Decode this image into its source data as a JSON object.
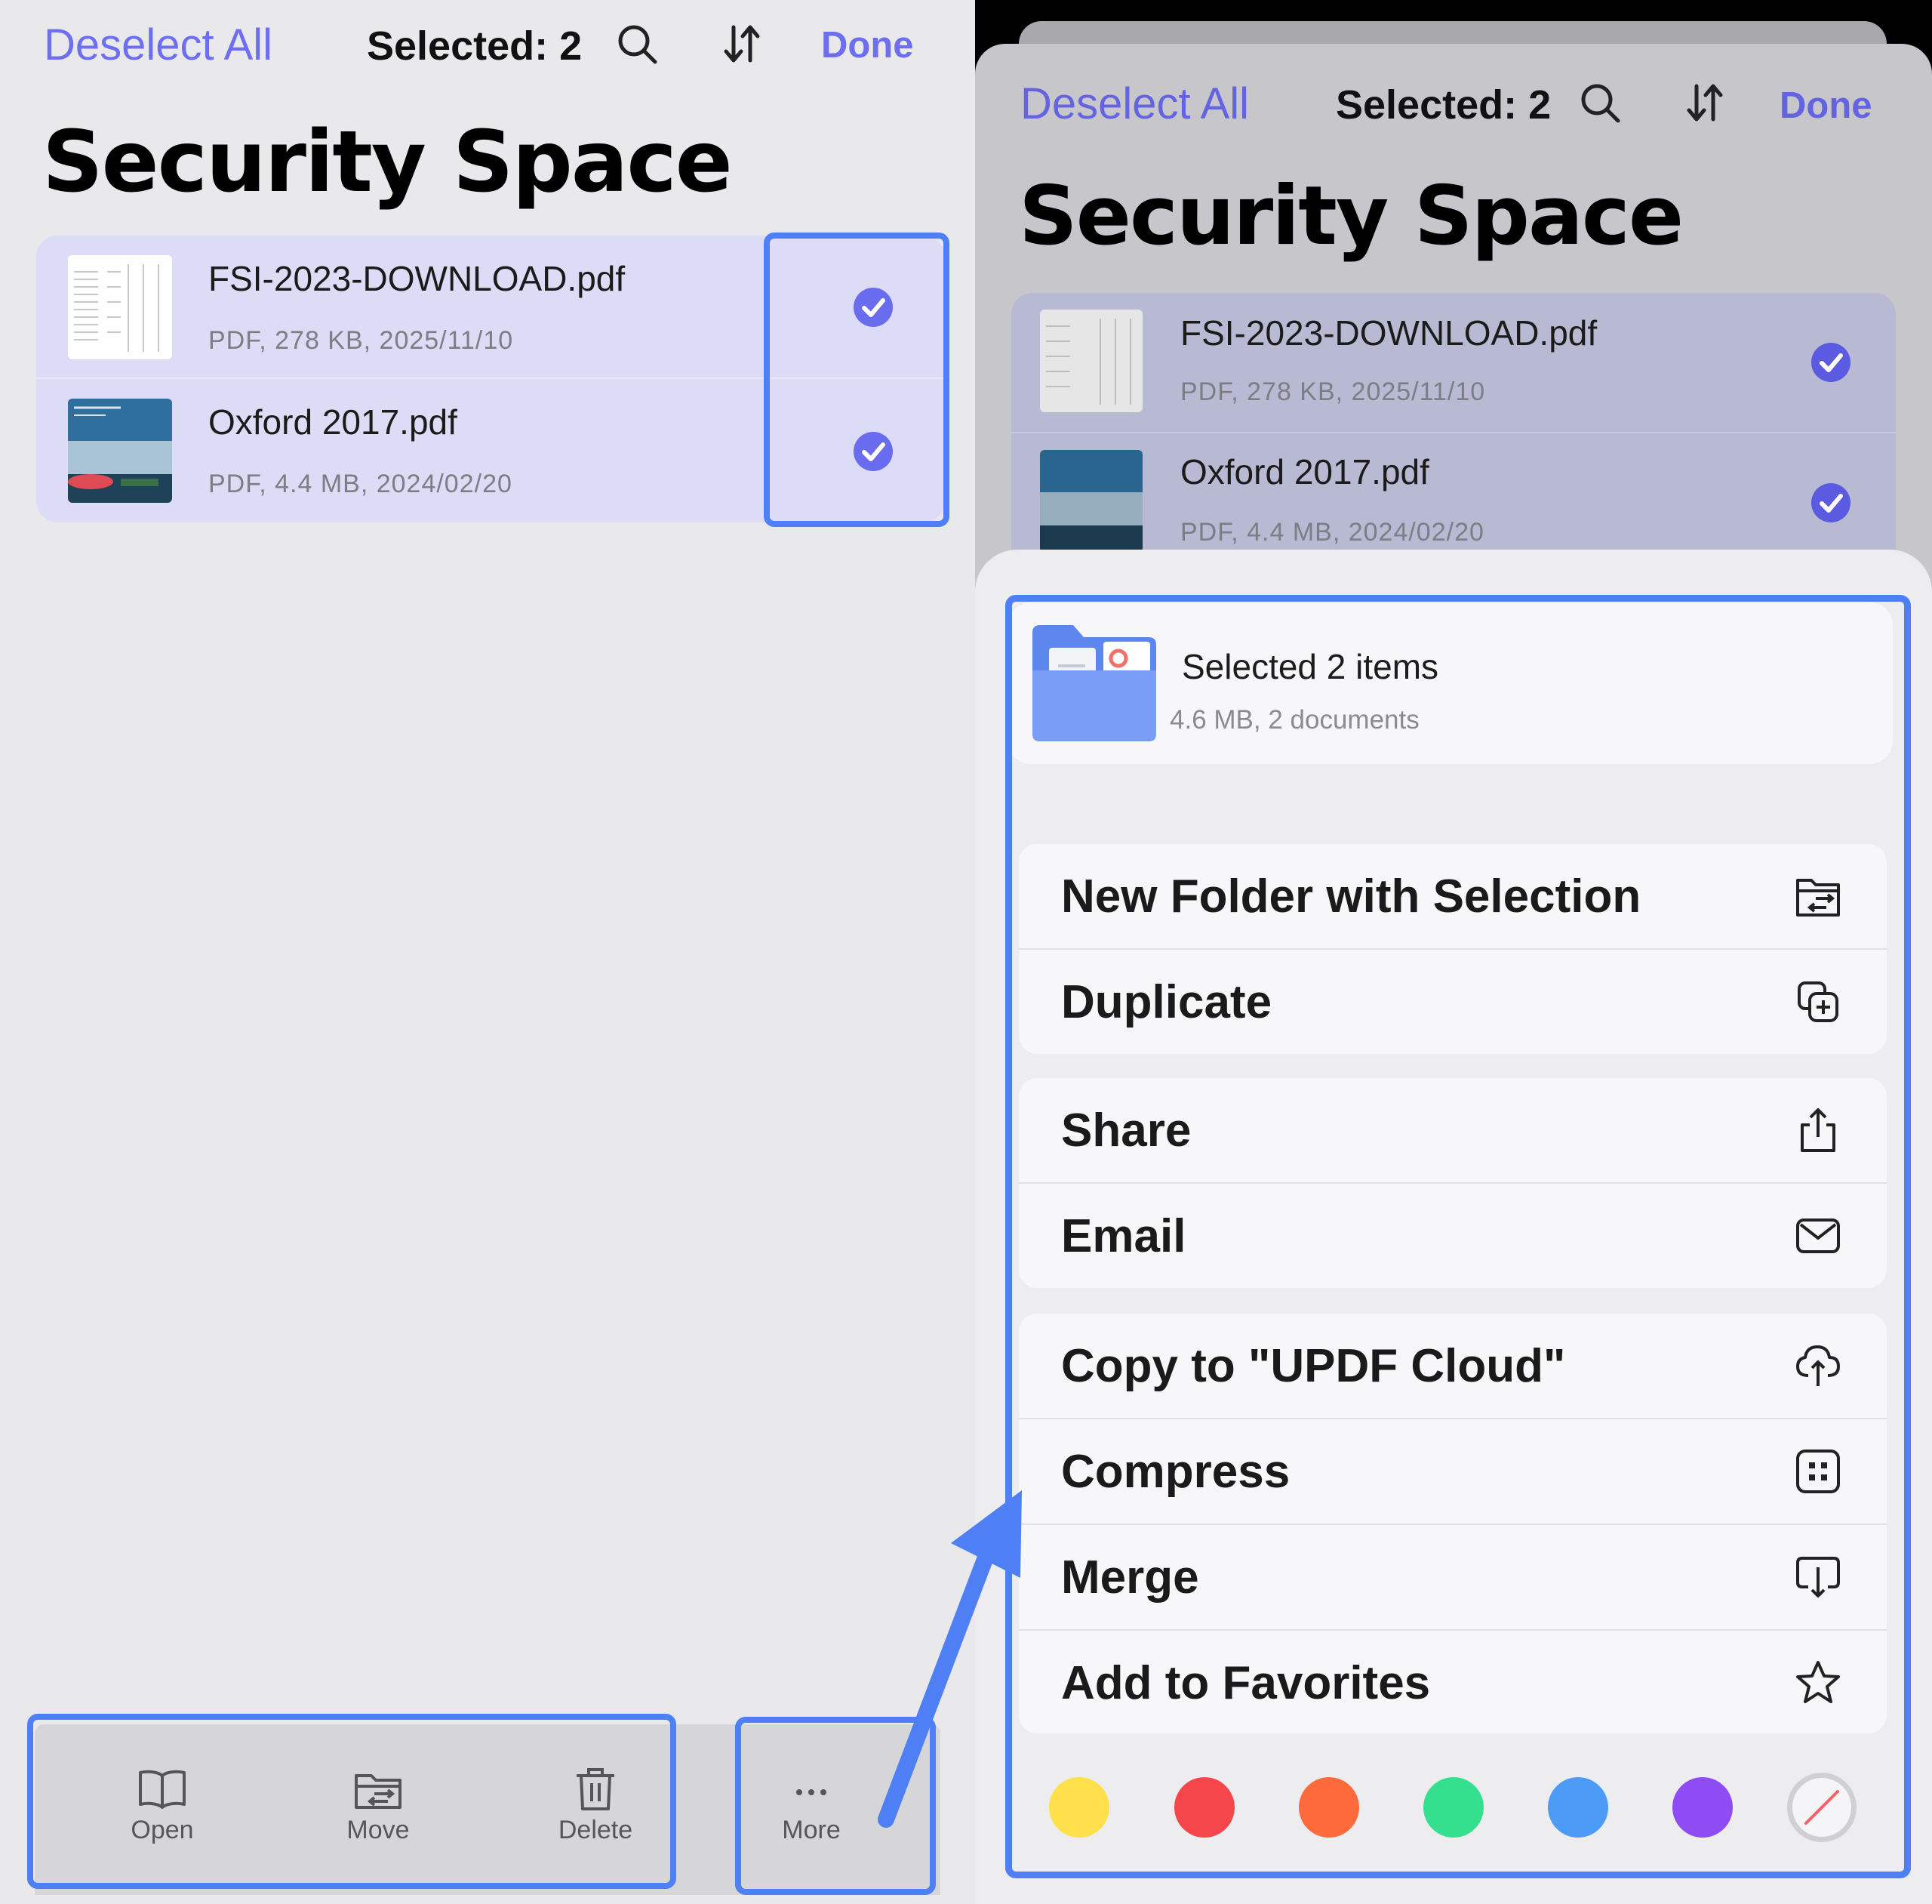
{
  "header": {
    "deselect_label": "Deselect All",
    "selected_label": "Selected: 2",
    "done_label": "Done",
    "title": "Security Space"
  },
  "files": [
    {
      "name": "FSI-2023-DOWNLOAD.pdf",
      "meta": "PDF, 278 KB, 2025/11/10",
      "checked": true
    },
    {
      "name": "Oxford 2017.pdf",
      "meta": "PDF, 4.4 MB, 2024/02/20",
      "checked": true
    }
  ],
  "toolbar": {
    "open_label": "Open",
    "move_label": "Move",
    "delete_label": "Delete",
    "more_label": "More"
  },
  "sheet": {
    "summary_title": "Selected 2 items",
    "summary_meta": "4.6 MB, 2 documents",
    "groups": [
      [
        {
          "label": "New Folder with Selection",
          "icon": "folder-move-icon"
        },
        {
          "label": "Duplicate",
          "icon": "duplicate-icon"
        }
      ],
      [
        {
          "label": "Share",
          "icon": "share-icon"
        },
        {
          "label": "Email",
          "icon": "envelope-icon"
        }
      ],
      [
        {
          "label": "Copy to \"UPDF Cloud\"",
          "icon": "cloud-upload-icon"
        },
        {
          "label": "Compress",
          "icon": "compress-icon"
        },
        {
          "label": "Merge",
          "icon": "merge-icon"
        },
        {
          "label": "Add to Favorites",
          "icon": "star-icon"
        }
      ]
    ],
    "tag_colors": [
      "#ffe04a",
      "#f5464b",
      "#ff6a3d",
      "#34e08e",
      "#4c9bf7",
      "#8e4cf5"
    ],
    "no_color_icon": "no-color-icon"
  },
  "colors": {
    "accent": "#6e6ff0",
    "highlight": "#4f7ff5",
    "selected_row": "#dcdcf6"
  }
}
